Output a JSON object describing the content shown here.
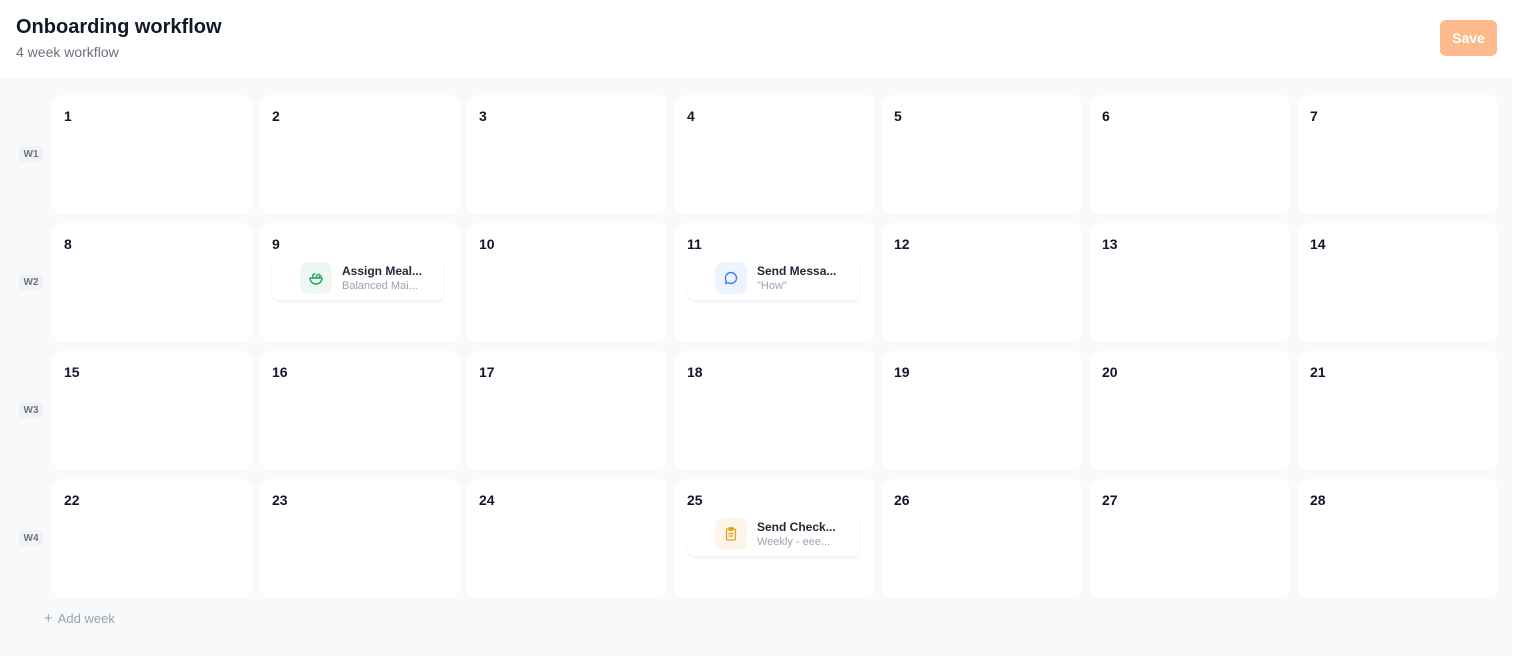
{
  "header": {
    "title": "Onboarding workflow",
    "subtitle": "4 week workflow",
    "save_label": "Save"
  },
  "colors": {
    "accent": "#fdba8c",
    "meal_icon": "#22a55b",
    "message_icon": "#3b82f6",
    "checkin_icon": "#e4a11b"
  },
  "weeks": [
    {
      "label": "W1",
      "days": [
        {
          "num": "1"
        },
        {
          "num": "2"
        },
        {
          "num": "3"
        },
        {
          "num": "4"
        },
        {
          "num": "5"
        },
        {
          "num": "6"
        },
        {
          "num": "7"
        }
      ]
    },
    {
      "label": "W2",
      "days": [
        {
          "num": "8"
        },
        {
          "num": "9",
          "task": {
            "icon": "salad-bowl-icon",
            "title": "Assign Meal...",
            "subtitle": "Balanced Mai..."
          }
        },
        {
          "num": "10"
        },
        {
          "num": "11",
          "task": {
            "icon": "chat-bubble-icon",
            "title": "Send Messa...",
            "subtitle": "\"How\""
          }
        },
        {
          "num": "12"
        },
        {
          "num": "13"
        },
        {
          "num": "14"
        }
      ]
    },
    {
      "label": "W3",
      "days": [
        {
          "num": "15"
        },
        {
          "num": "16"
        },
        {
          "num": "17"
        },
        {
          "num": "18"
        },
        {
          "num": "19"
        },
        {
          "num": "20"
        },
        {
          "num": "21"
        }
      ]
    },
    {
      "label": "W4",
      "days": [
        {
          "num": "22"
        },
        {
          "num": "23"
        },
        {
          "num": "24"
        },
        {
          "num": "25",
          "task": {
            "icon": "clipboard-icon",
            "title": "Send Check...",
            "subtitle": "Weekly - eee..."
          }
        },
        {
          "num": "26"
        },
        {
          "num": "27"
        },
        {
          "num": "28"
        }
      ]
    }
  ],
  "add_week_label": "Add week"
}
